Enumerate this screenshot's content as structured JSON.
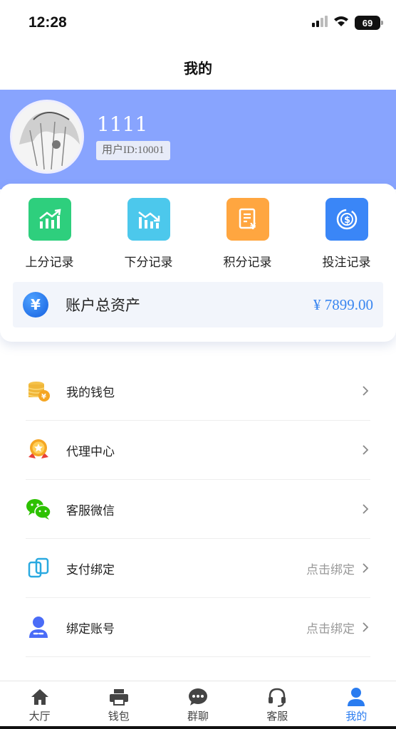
{
  "status_bar": {
    "time": "12:28",
    "battery": "69"
  },
  "nav": {
    "title": "我的"
  },
  "profile": {
    "username": "1111",
    "user_id": "用户ID:10001",
    "banner_color": "#88a4fe"
  },
  "quick_actions": [
    {
      "label": "上分记录",
      "icon": "chart-up-icon",
      "color": "#2ecf7d"
    },
    {
      "label": "下分记录",
      "icon": "chart-down-icon",
      "color": "#4cc8ec"
    },
    {
      "label": "积分记录",
      "icon": "receipt-yen-icon",
      "color": "#ffa640"
    },
    {
      "label": "投注记录",
      "icon": "dollar-coin-icon",
      "color": "#3a86f7"
    }
  ],
  "assets": {
    "label": "账户总资产",
    "value": "¥ 7899.00",
    "currency_symbol": "¥"
  },
  "menu": [
    {
      "label": "我的钱包",
      "icon": "coins-icon",
      "extra": ""
    },
    {
      "label": "代理中心",
      "icon": "medal-icon",
      "extra": ""
    },
    {
      "label": "客服微信",
      "icon": "wechat-icon",
      "extra": ""
    },
    {
      "label": "支付绑定",
      "icon": "link-card-icon",
      "extra": "点击绑定"
    },
    {
      "label": "绑定账号",
      "icon": "user-link-icon",
      "extra": "点击绑定"
    }
  ],
  "tabs": [
    {
      "label": "大厅",
      "icon": "home-icon",
      "active": false
    },
    {
      "label": "钱包",
      "icon": "printer-icon",
      "active": false
    },
    {
      "label": "群聊",
      "icon": "chat-icon",
      "active": false
    },
    {
      "label": "客服",
      "icon": "headset-icon",
      "active": false
    },
    {
      "label": "我的",
      "icon": "user-icon",
      "active": true
    }
  ],
  "colors": {
    "accent": "#2a7cf0",
    "assets_value": "#3a86f0"
  }
}
